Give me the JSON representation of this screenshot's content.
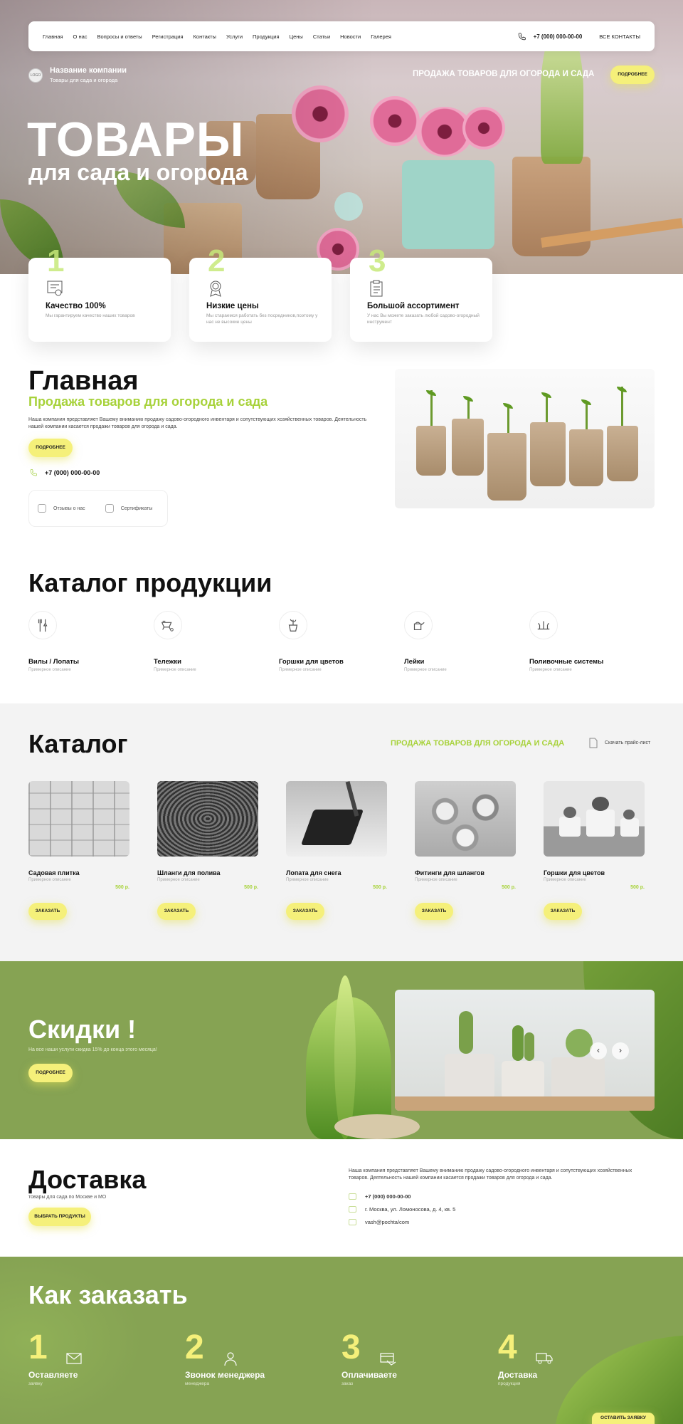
{
  "nav": {
    "items": [
      "Главная",
      "О нас",
      "Вопросы и ответы",
      "Регистрация",
      "Контакты",
      "Услуги",
      "Продукция",
      "Цены",
      "Статьи",
      "Новости",
      "Галерея"
    ],
    "phone": "+7 (000) 000-00-00",
    "all_contacts": "ВСЕ КОНТАКТЫ"
  },
  "brand": {
    "logo_text": "LOGO",
    "name": "Название компании",
    "tagline": "Товары для сада и огорода"
  },
  "hero": {
    "tag": "ПРОДАЖА ТОВАРОВ ДЛЯ ОГОРОДА И САДА",
    "more": "ПОДРОБНЕЕ",
    "title": "ТОВАРЫ",
    "subtitle": "для сада и огорода"
  },
  "features": [
    {
      "num": "1",
      "title": "Качество 100%",
      "desc": "Мы гарантируем качество наших товаров",
      "icon": "certificate-icon"
    },
    {
      "num": "2",
      "title": "Низкие цены",
      "desc": "Мы стараемся работать без посредников,поэтому у нас не высокие цены",
      "icon": "badge-icon"
    },
    {
      "num": "3",
      "title": "Большой ассортимент",
      "desc": "У нас Вы можете заказать любой садово-огородный инструмент",
      "icon": "clipboard-icon"
    }
  ],
  "main": {
    "title": "Главная",
    "subtitle": "Продажа товаров для огорода и сада",
    "text": "Наша компания представляет Вашему вниманию продажу садово-огородного инвентаря и сопутствующих хозяйственных товаров. Деятельность нашей компании касается продажи товаров для огорода и сада.",
    "more": "ПОДРОБНЕЕ",
    "phone": "+7 (000) 000-00-00",
    "reviews": "Отзывы о нас",
    "certs": "Сертификаты"
  },
  "products_section": {
    "title": "Каталог продукции",
    "items": [
      {
        "name": "Вилы / Лопаты",
        "desc": "Примерное описание",
        "icon": "rake-icon"
      },
      {
        "name": "Тележки",
        "desc": "Примерное описание",
        "icon": "wheelbarrow-icon"
      },
      {
        "name": "Горшки для цветов",
        "desc": "Примерное описание",
        "icon": "flower-pot-icon"
      },
      {
        "name": "Лейки",
        "desc": "Примерное описание",
        "icon": "watering-can-icon"
      },
      {
        "name": "Поливочные системы",
        "desc": "Примерное описание",
        "icon": "irrigation-icon"
      }
    ]
  },
  "catalog": {
    "title": "Каталог",
    "tag": "ПРОДАЖА ТОВАРОВ ДЛЯ ОГОРОДА И САДА",
    "price_list": "Скачать прайс-лист",
    "order": "ЗАКАЗАТЬ",
    "items": [
      {
        "name": "Садовая плитка",
        "desc": "Примерное описание",
        "price": "500 р."
      },
      {
        "name": "Шланги для полива",
        "desc": "Примерное описание",
        "price": "500 р."
      },
      {
        "name": "Лопата для снега",
        "desc": "Примерное описание",
        "price": "500 р."
      },
      {
        "name": "Фитинги для шлангов",
        "desc": "Примерное описание",
        "price": "500 р."
      },
      {
        "name": "Горшки для цветов",
        "desc": "Примерное описание",
        "price": "500 р."
      }
    ]
  },
  "discount": {
    "title": "Скидки !",
    "text": "На все наши услуги скидка 15% до конца этого месяца!",
    "more": "ПОДРОБНЕЕ",
    "prev": "‹",
    "next": "›"
  },
  "delivery": {
    "title": "Доставка",
    "subtitle": "товары для сада по Москве и МО",
    "button": "ВЫБРАТЬ ПРОДУКТЫ",
    "text": "Наша компания представляет Вашему вниманию продажу садово-огородного инвентаря и сопутствующих хозяйственных товаров. Деятельность нашей компании касается продажи товаров для огорода и сада.",
    "phone": "+7 (000) 000-00-00",
    "address": "г. Москва, ул. Ломоносова, д. 4, кв. 5",
    "email": "vash@pochta/com"
  },
  "how": {
    "title": "Как заказать",
    "button": "ОСТАВИТЬ ЗАЯВКУ",
    "steps": [
      {
        "num": "1",
        "title": "Оставляете",
        "sub": "заявку"
      },
      {
        "num": "2",
        "title": "Звонок менеджера",
        "sub": "менеджера"
      },
      {
        "num": "3",
        "title": "Оплачиваете",
        "sub": "заказ"
      },
      {
        "num": "4",
        "title": "Доставка",
        "sub": "продукция"
      }
    ]
  },
  "colors": {
    "accent_yellow": "#f5f07a",
    "accent_green": "#a7d23a",
    "olive": "#86a353"
  }
}
